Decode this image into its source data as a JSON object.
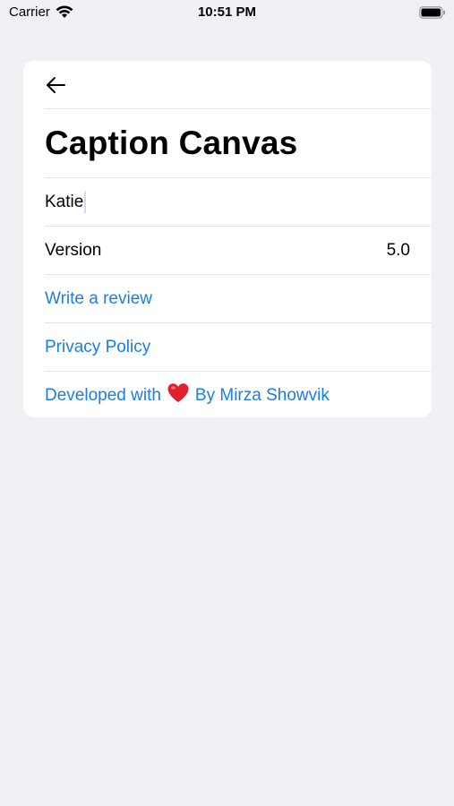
{
  "status_bar": {
    "carrier": "Carrier",
    "time": "10:51 PM"
  },
  "header": {
    "back_icon": "arrow-left-icon",
    "title": "Caption Canvas"
  },
  "name_field": {
    "value": "Katie"
  },
  "version_row": {
    "label": "Version",
    "value": "5.0"
  },
  "links": {
    "review": "Write a review",
    "privacy": "Privacy Policy",
    "developed_prefix": "Developed with",
    "developed_suffix": "By Mirza Showvik"
  },
  "colors": {
    "background": "#f0f0f5",
    "card": "#ffffff",
    "link": "#1a7fe0",
    "heart": "#e0202a"
  }
}
